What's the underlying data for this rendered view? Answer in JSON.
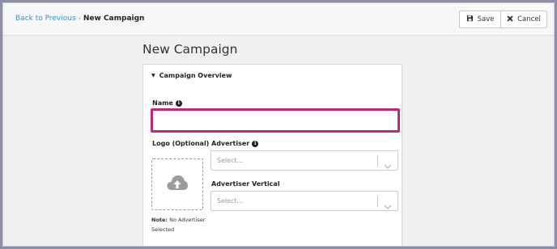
{
  "breadcrumb": {
    "back_label": "Back to Previous",
    "separator": "›",
    "current": "New Campaign"
  },
  "toolbar": {
    "save_label": "Save",
    "save_icon": "floppy-disk-icon",
    "cancel_label": "Cancel",
    "cancel_icon": "close-icon"
  },
  "page": {
    "title": "New Campaign"
  },
  "campaign_overview": {
    "section_title": "Campaign Overview",
    "name_label": "Name",
    "name_value": "",
    "logo_label": "Logo (Optional)",
    "note_label": "Note:",
    "note_text": "No Advertiser Selected",
    "advertiser_label": "Advertiser",
    "advertiser_placeholder": "Select...",
    "advertiser_vertical_label": "Advertiser Vertical",
    "advertiser_vertical_placeholder": "Select..."
  },
  "colors": {
    "link": "#3f8ec7",
    "focus_border": "#c0267a",
    "outer_border": "#8c8fa6"
  }
}
